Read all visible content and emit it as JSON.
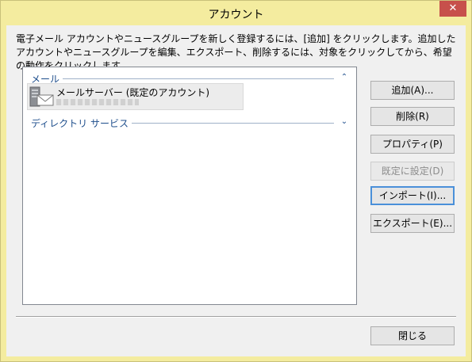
{
  "window": {
    "title": "アカウント",
    "close_glyph": "✕",
    "frame_color": "#f4ec9f",
    "close_color": "#c7504b"
  },
  "description": "電子メール アカウントやニュースグループを新しく登録するには、[追加] をクリックします。追加したアカウントやニュースグループを編集、エクスポート、削除するには、対象をクリックしてから、希望の動作をクリックします。",
  "accounts_list": {
    "groups": [
      {
        "label": "メール",
        "chevron": "up-chevron-icon",
        "chevron_glyph": "⌃"
      },
      {
        "label": "ディレクトリ サービス",
        "chevron": "down-chevron-icon",
        "chevron_glyph": "⌄"
      }
    ],
    "mail_account": {
      "name": "メールサーバー (既定のアカウント)",
      "icon": "mail-server-icon"
    }
  },
  "buttons": {
    "add": "追加(A)...",
    "remove": "削除(R)",
    "properties": "プロパティ(P)",
    "set_default": "既定に設定(D)",
    "import": "インポート(I)...",
    "export": "エクスポート(E)...",
    "close": "閉じる"
  },
  "colors": {
    "group_header": "#1e4e8c",
    "focus_border": "#4a90d9"
  }
}
